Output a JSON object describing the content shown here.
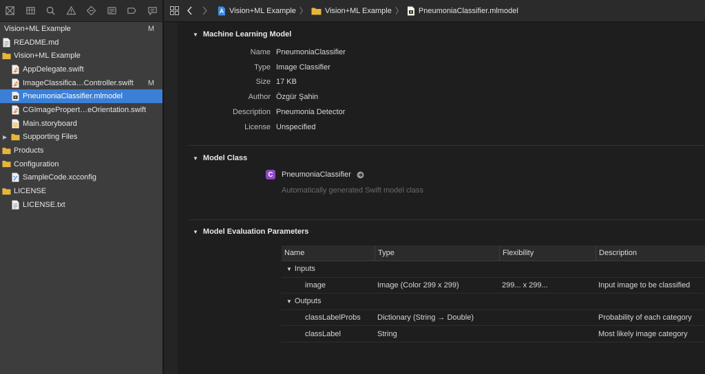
{
  "navigator": {
    "toolbar_icons": [
      "project-navigator-icon",
      "source-control-icon",
      "find-icon",
      "issue-icon",
      "test-icon",
      "debug-icon",
      "breakpoint-icon",
      "report-icon"
    ],
    "project": {
      "label": "Vision+ML Example",
      "badge": "M"
    },
    "items": [
      {
        "label": "README.md",
        "icon": "text-file-icon",
        "level": 0,
        "badge": ""
      },
      {
        "label": "Vision+ML Example",
        "icon": "folder-icon",
        "level": 0,
        "badge": "",
        "expanded": true
      },
      {
        "label": "AppDelegate.swift",
        "icon": "swift-file-icon",
        "level": 1,
        "badge": ""
      },
      {
        "label": "ImageClassifica…Controller.swift",
        "icon": "swift-file-icon",
        "level": 1,
        "badge": "M"
      },
      {
        "label": "PneumoniaClassifier.mlmodel",
        "icon": "mlmodel-file-icon",
        "level": 1,
        "badge": "",
        "selected": true
      },
      {
        "label": "CGImagePropert…eOrientation.swift",
        "icon": "swift-file-icon",
        "level": 1,
        "badge": ""
      },
      {
        "label": "Main.storyboard",
        "icon": "storyboard-file-icon",
        "level": 1,
        "badge": ""
      },
      {
        "label": "Supporting Files",
        "icon": "folder-icon",
        "level": 1,
        "badge": "",
        "collapsed": true
      },
      {
        "label": "Products",
        "icon": "folder-icon",
        "level": 0,
        "badge": ""
      },
      {
        "label": "Configuration",
        "icon": "folder-icon",
        "level": 0,
        "badge": ""
      },
      {
        "label": "SampleCode.xcconfig",
        "icon": "config-file-icon",
        "level": 1,
        "badge": ""
      },
      {
        "label": "LICENSE",
        "icon": "folder-icon",
        "level": 0,
        "badge": ""
      },
      {
        "label": "LICENSE.txt",
        "icon": "text-file-icon",
        "level": 1,
        "badge": ""
      }
    ]
  },
  "breadcrumb": {
    "items": [
      "Vision+ML Example",
      "Vision+ML Example",
      "PneumoniaClassifier.mlmodel"
    ]
  },
  "ml_model": {
    "title": "Machine Learning Model",
    "properties": [
      {
        "label": "Name",
        "value": "PneumoniaClassifier"
      },
      {
        "label": "Type",
        "value": "Image Classifier"
      },
      {
        "label": "Size",
        "value": "17 KB"
      },
      {
        "label": "Author",
        "value": "Özgür Şahin"
      },
      {
        "label": "Description",
        "value": "Pneumonia Detector"
      },
      {
        "label": "License",
        "value": "Unspecified"
      }
    ]
  },
  "model_class": {
    "title": "Model Class",
    "badge": "C",
    "name": "PneumoniaClassifier",
    "subtitle": "Automatically generated Swift model class"
  },
  "evaluation": {
    "title": "Model Evaluation Parameters",
    "columns": [
      "Name",
      "Type",
      "Flexibility",
      "Description"
    ],
    "inputs_label": "Inputs",
    "outputs_label": "Outputs",
    "inputs": [
      {
        "name": "image",
        "type": "Image (Color 299 x 299)",
        "flexibility": "299... x 299...",
        "description": "Input image to be classified"
      }
    ],
    "outputs": [
      {
        "name": "classLabelProbs",
        "type": "Dictionary (String → Double)",
        "flexibility": "",
        "description": "Probability of each category"
      },
      {
        "name": "classLabel",
        "type": "String",
        "flexibility": "",
        "description": "Most likely image category"
      }
    ]
  },
  "colors": {
    "selection": "#3b7fd6",
    "folder": "#e8b53c",
    "class_badge": "#8e48c4"
  }
}
